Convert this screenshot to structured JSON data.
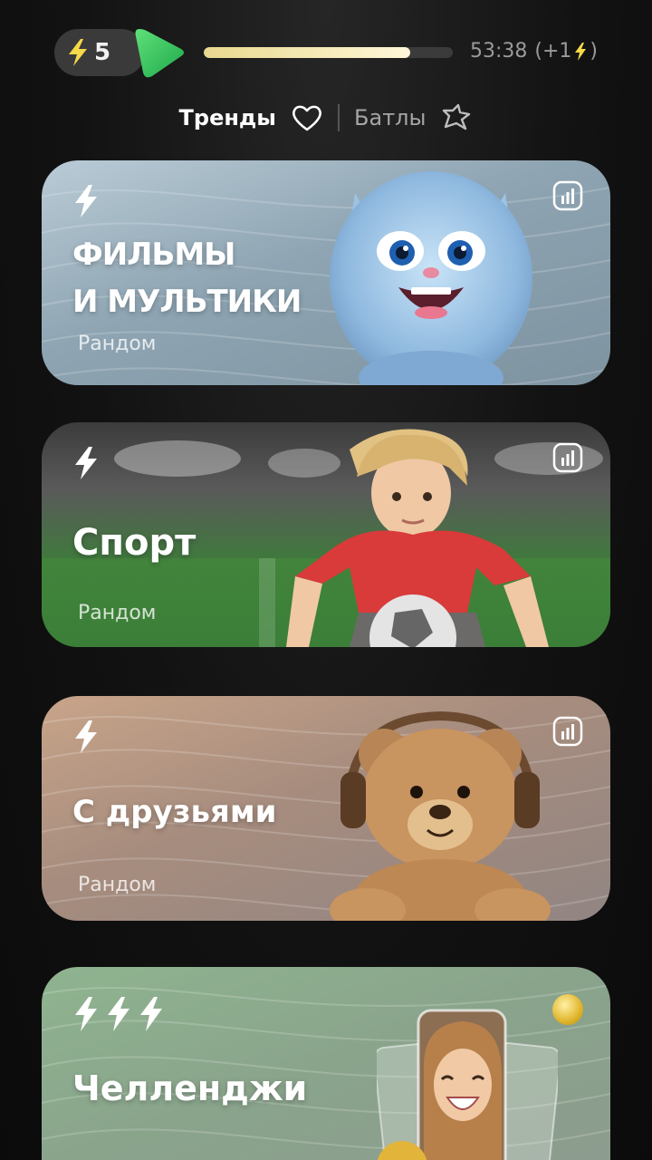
{
  "status": {
    "energy_count": "5",
    "progress_fraction": 0.83,
    "timer_text": "53:38",
    "timer_bonus_prefix": "(+1",
    "timer_bonus_suffix": ")"
  },
  "tabs": [
    {
      "label": "Тренды",
      "icon": "heart-icon",
      "active": true
    },
    {
      "label": "Батлы",
      "icon": "star-icon",
      "active": false
    }
  ],
  "cards": [
    {
      "title_line1": "ФИЛЬМЫ",
      "title_line2": "И МУЛЬТИКИ",
      "subtitle": "Рандом",
      "icon": "bolt-icon",
      "badge": "stats-icon",
      "art": "fluffy-monster"
    },
    {
      "title": "Спорт",
      "subtitle": "Рандом",
      "icon": "bolt-icon",
      "badge": "stats-icon",
      "art": "boy-with-soccer-ball"
    },
    {
      "title": "С друзьями",
      "subtitle": "Рандом",
      "icon": "bolt-icon",
      "badge": "stats-icon",
      "art": "teddy-bear-headphones"
    },
    {
      "title": "Челленджи",
      "icon": "triple-bolt-icon",
      "badge": "coin-icon",
      "art": "laughing-girl-cards"
    }
  ],
  "colors": {
    "accent_green": "#2fc85a",
    "energy_yellow": "#f5d94a",
    "progress_fill": "#f3e8b5"
  }
}
